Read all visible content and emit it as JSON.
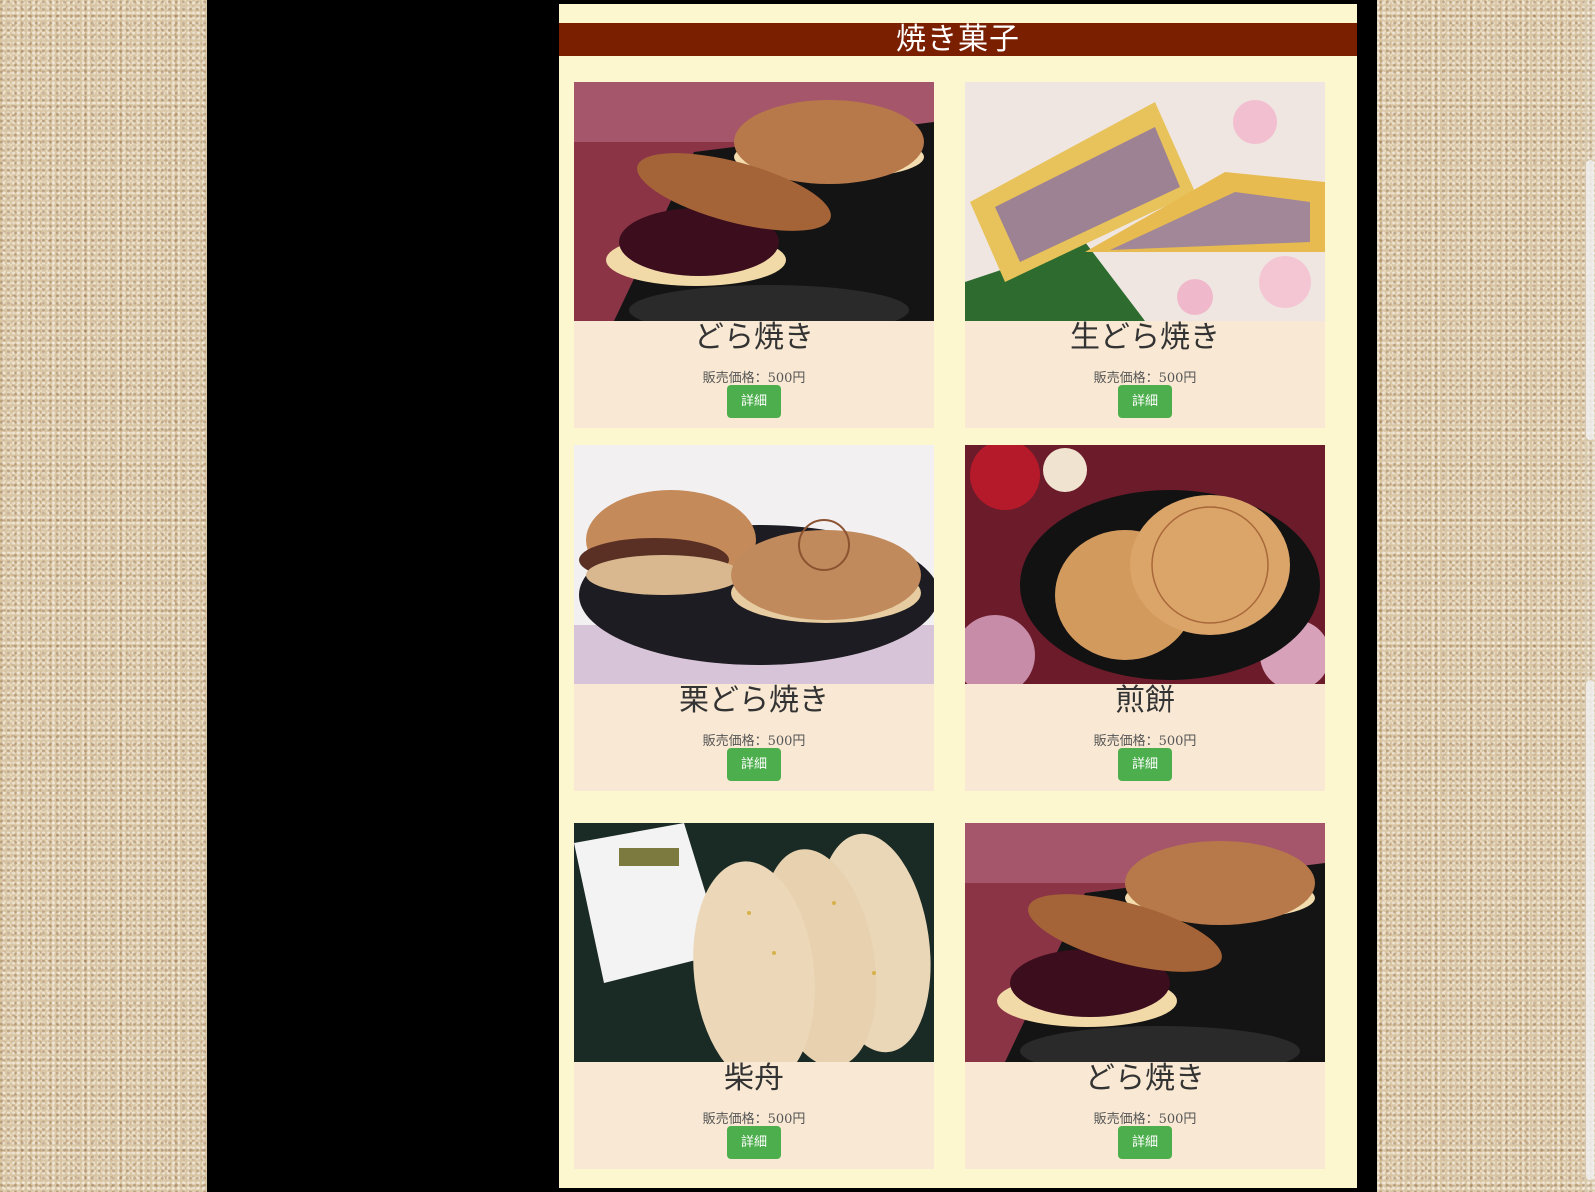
{
  "section": {
    "title": "焼き菓子"
  },
  "colors": {
    "header_bg": "#7a1f00",
    "panel_bg": "#fdf7cf",
    "card_bg": "#f9e9d4",
    "button_bg": "#4cae4c"
  },
  "products": [
    {
      "name": "どら焼き",
      "price": "販売価格：500円",
      "button": "詳細",
      "image": "dorayaki-photo"
    },
    {
      "name": "生どら焼き",
      "price": "販売価格：500円",
      "button": "詳細",
      "image": "nama-dorayaki-photo"
    },
    {
      "name": "栗どら焼き",
      "price": "販売価格：500円",
      "button": "詳細",
      "image": "kuri-dorayaki-photo"
    },
    {
      "name": "煎餅",
      "price": "販売価格：500円",
      "button": "詳細",
      "image": "senbei-photo"
    },
    {
      "name": "柴舟",
      "price": "販売価格：500円",
      "button": "詳細",
      "image": "shibafune-photo"
    },
    {
      "name": "どら焼き",
      "price": "販売価格：500円",
      "button": "詳細",
      "image": "dorayaki-photo"
    }
  ]
}
